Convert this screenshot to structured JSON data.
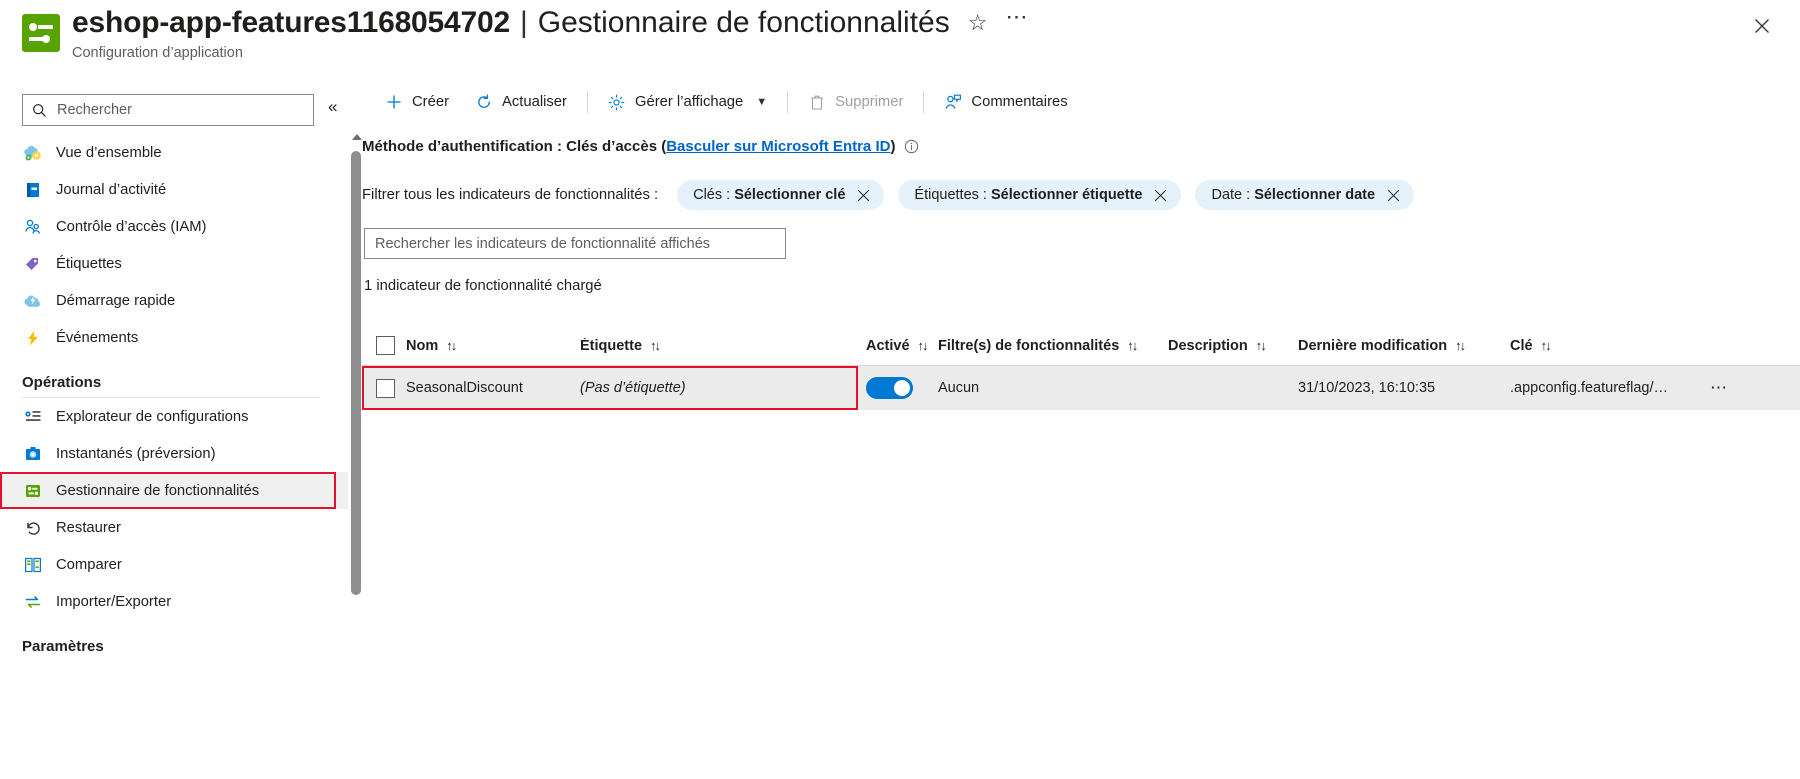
{
  "header": {
    "resource_name": "eshop-app-features1168054702",
    "separator": "|",
    "blade_name": "Gestionnaire de fonctionnalités",
    "subtitle": "Configuration d’application",
    "favorite_icon": "star-icon",
    "more_icon": "ellipsis-icon",
    "close_icon": "close-icon",
    "icon_color": "#57a300"
  },
  "sidebar": {
    "search": {
      "placeholder": "Rechercher",
      "value": "",
      "icon": "search-icon"
    },
    "collapse_icon": "double-chevron-left-icon",
    "items": [
      {
        "label": "Vue d’ensemble",
        "icon": "overview-cloud-gear-icon",
        "selected": false
      },
      {
        "label": "Journal d’activité",
        "icon": "activity-log-book-icon",
        "selected": false
      },
      {
        "label": "Contrôle d’accès (IAM)",
        "icon": "access-control-people-icon",
        "selected": false
      },
      {
        "label": "Étiquettes",
        "icon": "tag-icon",
        "selected": false
      },
      {
        "label": "Démarrage rapide",
        "icon": "quickstart-cloud-icon",
        "selected": false
      },
      {
        "label": "Événements",
        "icon": "events-lightning-icon",
        "selected": false
      }
    ],
    "group_operations": "Opérations",
    "operations_items": [
      {
        "label": "Explorateur de configurations",
        "icon": "config-explorer-icon",
        "selected": false
      },
      {
        "label": "Instantanés (préversion)",
        "icon": "snapshot-camera-icon",
        "selected": false
      },
      {
        "label": "Gestionnaire de fonctionnalités",
        "icon": "feature-manager-icon",
        "selected": true
      },
      {
        "label": "Restaurer",
        "icon": "restore-undo-icon",
        "selected": false
      },
      {
        "label": "Comparer",
        "icon": "compare-icon",
        "selected": false
      },
      {
        "label": "Importer/Exporter",
        "icon": "import-export-arrows-icon",
        "selected": false
      }
    ],
    "group_settings": "Paramètres"
  },
  "toolbar": {
    "create": {
      "label": "Créer",
      "icon": "plus-icon"
    },
    "refresh": {
      "label": "Actualiser",
      "icon": "refresh-icon"
    },
    "manage_view": {
      "label": "Gérer l’affichage",
      "icon": "gear-icon",
      "chevron": "chevron-down-icon"
    },
    "delete": {
      "label": "Supprimer",
      "icon": "trash-icon",
      "disabled": true
    },
    "feedback": {
      "label": "Commentaires",
      "icon": "feedback-person-icon"
    }
  },
  "content": {
    "auth_method_prefix": "Méthode d’authentification : Clés d’accès (",
    "auth_method_link": "Basculer sur Microsoft Entra ID",
    "auth_method_suffix": ")",
    "info_icon": "info-circle-icon",
    "filter_label": "Filtrer tous les indicateurs de fonctionnalités :",
    "filters": [
      {
        "prefix": "Clés : ",
        "value": "Sélectionner clé",
        "clear_icon": "close-icon"
      },
      {
        "prefix": "Étiquettes : ",
        "value": "Sélectionner étiquette",
        "clear_icon": "close-icon"
      },
      {
        "prefix": "Date : ",
        "value": "Sélectionner date",
        "clear_icon": "close-icon"
      }
    ],
    "search_placeholder": "Rechercher les indicateurs de fonctionnalité affichés",
    "search_value": "",
    "count_text": "1 indicateur de fonctionnalité chargé",
    "table": {
      "columns": [
        {
          "label": "Nom",
          "sort": "↑↓"
        },
        {
          "label": "Étiquette",
          "sort": "↑↓"
        },
        {
          "label": "Activé",
          "sort": "↑↓"
        },
        {
          "label": "Filtre(s) de fonctionnalités",
          "sort": "↑↓"
        },
        {
          "label": "Description",
          "sort": "↑↓"
        },
        {
          "label": "Dernière modification",
          "sort": "↑↓"
        },
        {
          "label": "Clé",
          "sort": "↑↓"
        }
      ],
      "rows": [
        {
          "name": "SeasonalDiscount",
          "tag": "(Pas d’étiquette)",
          "enabled": true,
          "filters": "Aucun",
          "description": "",
          "last_modified": "31/10/2023, 16:10:35",
          "key": ".appconfig.featureflag/…",
          "more_icon": "ellipsis-icon"
        }
      ]
    },
    "highlight_color": "#e8112d",
    "toggle_on_color": "#0078d4",
    "link_color": "#0064c8"
  }
}
